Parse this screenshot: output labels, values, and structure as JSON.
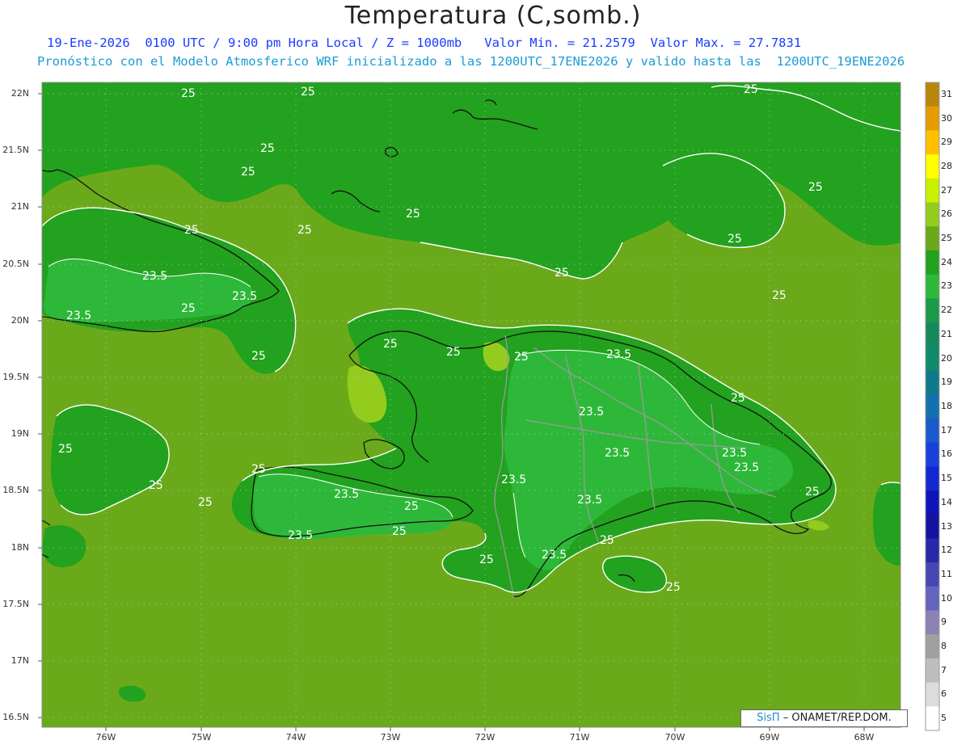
{
  "header": {
    "title": "Temperatura (C,somb.)",
    "line1": "19-Ene-2026  0100 UTC / 9:00 pm Hora Local / Z = 1000mb   Valor Min. = 21.2579  Valor Max. = 27.7831",
    "line2": "Pronóstico con el Modelo Atmosferico WRF inicializado a las 1200UTC_17ENE2026 y valido hasta las  1200UTC_19ENE2026"
  },
  "axes": {
    "lat_labels": [
      "22N",
      "21.5N",
      "21N",
      "20.5N",
      "20N",
      "19.5N",
      "19N",
      "18.5N",
      "18N",
      "17.5N",
      "17N",
      "16.5N"
    ],
    "lon_labels": [
      "76W",
      "75W",
      "74W",
      "73W",
      "72W",
      "71W",
      "70W",
      "69W",
      "68W"
    ]
  },
  "colorbar": {
    "labels": [
      "31",
      "30",
      "29",
      "28",
      "27",
      "26",
      "25",
      "24",
      "23",
      "22",
      "21",
      "20",
      "19",
      "18",
      "17",
      "16",
      "15",
      "14",
      "13",
      "12",
      "11",
      "10",
      "9",
      "8",
      "7",
      "6",
      "5"
    ],
    "colors": [
      "#b8860b",
      "#e69b00",
      "#ffc000",
      "#ffff00",
      "#c8f000",
      "#94cc1e",
      "#6aaa1a",
      "#22a21e",
      "#2eb83a",
      "#1a9a4a",
      "#148a5a",
      "#0f8a6a",
      "#0e7a8a",
      "#1470b0",
      "#1a5acc",
      "#1a40dc",
      "#1428d2",
      "#0f14b8",
      "#1414a0",
      "#2828a8",
      "#4646b4",
      "#6464be",
      "#8c82b4",
      "#a0a0a0",
      "#bebebe",
      "#dcdcdc",
      "#ffffff"
    ]
  },
  "contour_labels": [
    "25",
    "23.5"
  ],
  "credit": {
    "brand": "SisΠ",
    "text": "– ONAMET/REP.DOM."
  }
}
